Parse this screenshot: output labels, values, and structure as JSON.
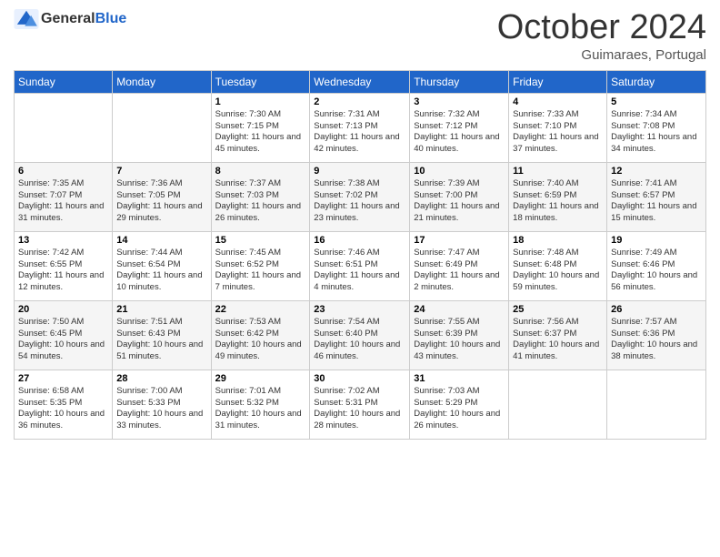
{
  "header": {
    "logo": {
      "general": "General",
      "blue": "Blue",
      "tagline": ""
    },
    "title": "October 2024",
    "location": "Guimaraes, Portugal"
  },
  "days_of_week": [
    "Sunday",
    "Monday",
    "Tuesday",
    "Wednesday",
    "Thursday",
    "Friday",
    "Saturday"
  ],
  "weeks": [
    [
      {
        "day": "",
        "sunrise": "",
        "sunset": "",
        "daylight": ""
      },
      {
        "day": "",
        "sunrise": "",
        "sunset": "",
        "daylight": ""
      },
      {
        "day": "1",
        "sunrise": "Sunrise: 7:30 AM",
        "sunset": "Sunset: 7:15 PM",
        "daylight": "Daylight: 11 hours and 45 minutes."
      },
      {
        "day": "2",
        "sunrise": "Sunrise: 7:31 AM",
        "sunset": "Sunset: 7:13 PM",
        "daylight": "Daylight: 11 hours and 42 minutes."
      },
      {
        "day": "3",
        "sunrise": "Sunrise: 7:32 AM",
        "sunset": "Sunset: 7:12 PM",
        "daylight": "Daylight: 11 hours and 40 minutes."
      },
      {
        "day": "4",
        "sunrise": "Sunrise: 7:33 AM",
        "sunset": "Sunset: 7:10 PM",
        "daylight": "Daylight: 11 hours and 37 minutes."
      },
      {
        "day": "5",
        "sunrise": "Sunrise: 7:34 AM",
        "sunset": "Sunset: 7:08 PM",
        "daylight": "Daylight: 11 hours and 34 minutes."
      }
    ],
    [
      {
        "day": "6",
        "sunrise": "Sunrise: 7:35 AM",
        "sunset": "Sunset: 7:07 PM",
        "daylight": "Daylight: 11 hours and 31 minutes."
      },
      {
        "day": "7",
        "sunrise": "Sunrise: 7:36 AM",
        "sunset": "Sunset: 7:05 PM",
        "daylight": "Daylight: 11 hours and 29 minutes."
      },
      {
        "day": "8",
        "sunrise": "Sunrise: 7:37 AM",
        "sunset": "Sunset: 7:03 PM",
        "daylight": "Daylight: 11 hours and 26 minutes."
      },
      {
        "day": "9",
        "sunrise": "Sunrise: 7:38 AM",
        "sunset": "Sunset: 7:02 PM",
        "daylight": "Daylight: 11 hours and 23 minutes."
      },
      {
        "day": "10",
        "sunrise": "Sunrise: 7:39 AM",
        "sunset": "Sunset: 7:00 PM",
        "daylight": "Daylight: 11 hours and 21 minutes."
      },
      {
        "day": "11",
        "sunrise": "Sunrise: 7:40 AM",
        "sunset": "Sunset: 6:59 PM",
        "daylight": "Daylight: 11 hours and 18 minutes."
      },
      {
        "day": "12",
        "sunrise": "Sunrise: 7:41 AM",
        "sunset": "Sunset: 6:57 PM",
        "daylight": "Daylight: 11 hours and 15 minutes."
      }
    ],
    [
      {
        "day": "13",
        "sunrise": "Sunrise: 7:42 AM",
        "sunset": "Sunset: 6:55 PM",
        "daylight": "Daylight: 11 hours and 12 minutes."
      },
      {
        "day": "14",
        "sunrise": "Sunrise: 7:44 AM",
        "sunset": "Sunset: 6:54 PM",
        "daylight": "Daylight: 11 hours and 10 minutes."
      },
      {
        "day": "15",
        "sunrise": "Sunrise: 7:45 AM",
        "sunset": "Sunset: 6:52 PM",
        "daylight": "Daylight: 11 hours and 7 minutes."
      },
      {
        "day": "16",
        "sunrise": "Sunrise: 7:46 AM",
        "sunset": "Sunset: 6:51 PM",
        "daylight": "Daylight: 11 hours and 4 minutes."
      },
      {
        "day": "17",
        "sunrise": "Sunrise: 7:47 AM",
        "sunset": "Sunset: 6:49 PM",
        "daylight": "Daylight: 11 hours and 2 minutes."
      },
      {
        "day": "18",
        "sunrise": "Sunrise: 7:48 AM",
        "sunset": "Sunset: 6:48 PM",
        "daylight": "Daylight: 10 hours and 59 minutes."
      },
      {
        "day": "19",
        "sunrise": "Sunrise: 7:49 AM",
        "sunset": "Sunset: 6:46 PM",
        "daylight": "Daylight: 10 hours and 56 minutes."
      }
    ],
    [
      {
        "day": "20",
        "sunrise": "Sunrise: 7:50 AM",
        "sunset": "Sunset: 6:45 PM",
        "daylight": "Daylight: 10 hours and 54 minutes."
      },
      {
        "day": "21",
        "sunrise": "Sunrise: 7:51 AM",
        "sunset": "Sunset: 6:43 PM",
        "daylight": "Daylight: 10 hours and 51 minutes."
      },
      {
        "day": "22",
        "sunrise": "Sunrise: 7:53 AM",
        "sunset": "Sunset: 6:42 PM",
        "daylight": "Daylight: 10 hours and 49 minutes."
      },
      {
        "day": "23",
        "sunrise": "Sunrise: 7:54 AM",
        "sunset": "Sunset: 6:40 PM",
        "daylight": "Daylight: 10 hours and 46 minutes."
      },
      {
        "day": "24",
        "sunrise": "Sunrise: 7:55 AM",
        "sunset": "Sunset: 6:39 PM",
        "daylight": "Daylight: 10 hours and 43 minutes."
      },
      {
        "day": "25",
        "sunrise": "Sunrise: 7:56 AM",
        "sunset": "Sunset: 6:37 PM",
        "daylight": "Daylight: 10 hours and 41 minutes."
      },
      {
        "day": "26",
        "sunrise": "Sunrise: 7:57 AM",
        "sunset": "Sunset: 6:36 PM",
        "daylight": "Daylight: 10 hours and 38 minutes."
      }
    ],
    [
      {
        "day": "27",
        "sunrise": "Sunrise: 6:58 AM",
        "sunset": "Sunset: 5:35 PM",
        "daylight": "Daylight: 10 hours and 36 minutes."
      },
      {
        "day": "28",
        "sunrise": "Sunrise: 7:00 AM",
        "sunset": "Sunset: 5:33 PM",
        "daylight": "Daylight: 10 hours and 33 minutes."
      },
      {
        "day": "29",
        "sunrise": "Sunrise: 7:01 AM",
        "sunset": "Sunset: 5:32 PM",
        "daylight": "Daylight: 10 hours and 31 minutes."
      },
      {
        "day": "30",
        "sunrise": "Sunrise: 7:02 AM",
        "sunset": "Sunset: 5:31 PM",
        "daylight": "Daylight: 10 hours and 28 minutes."
      },
      {
        "day": "31",
        "sunrise": "Sunrise: 7:03 AM",
        "sunset": "Sunset: 5:29 PM",
        "daylight": "Daylight: 10 hours and 26 minutes."
      },
      {
        "day": "",
        "sunrise": "",
        "sunset": "",
        "daylight": ""
      },
      {
        "day": "",
        "sunrise": "",
        "sunset": "",
        "daylight": ""
      }
    ]
  ]
}
